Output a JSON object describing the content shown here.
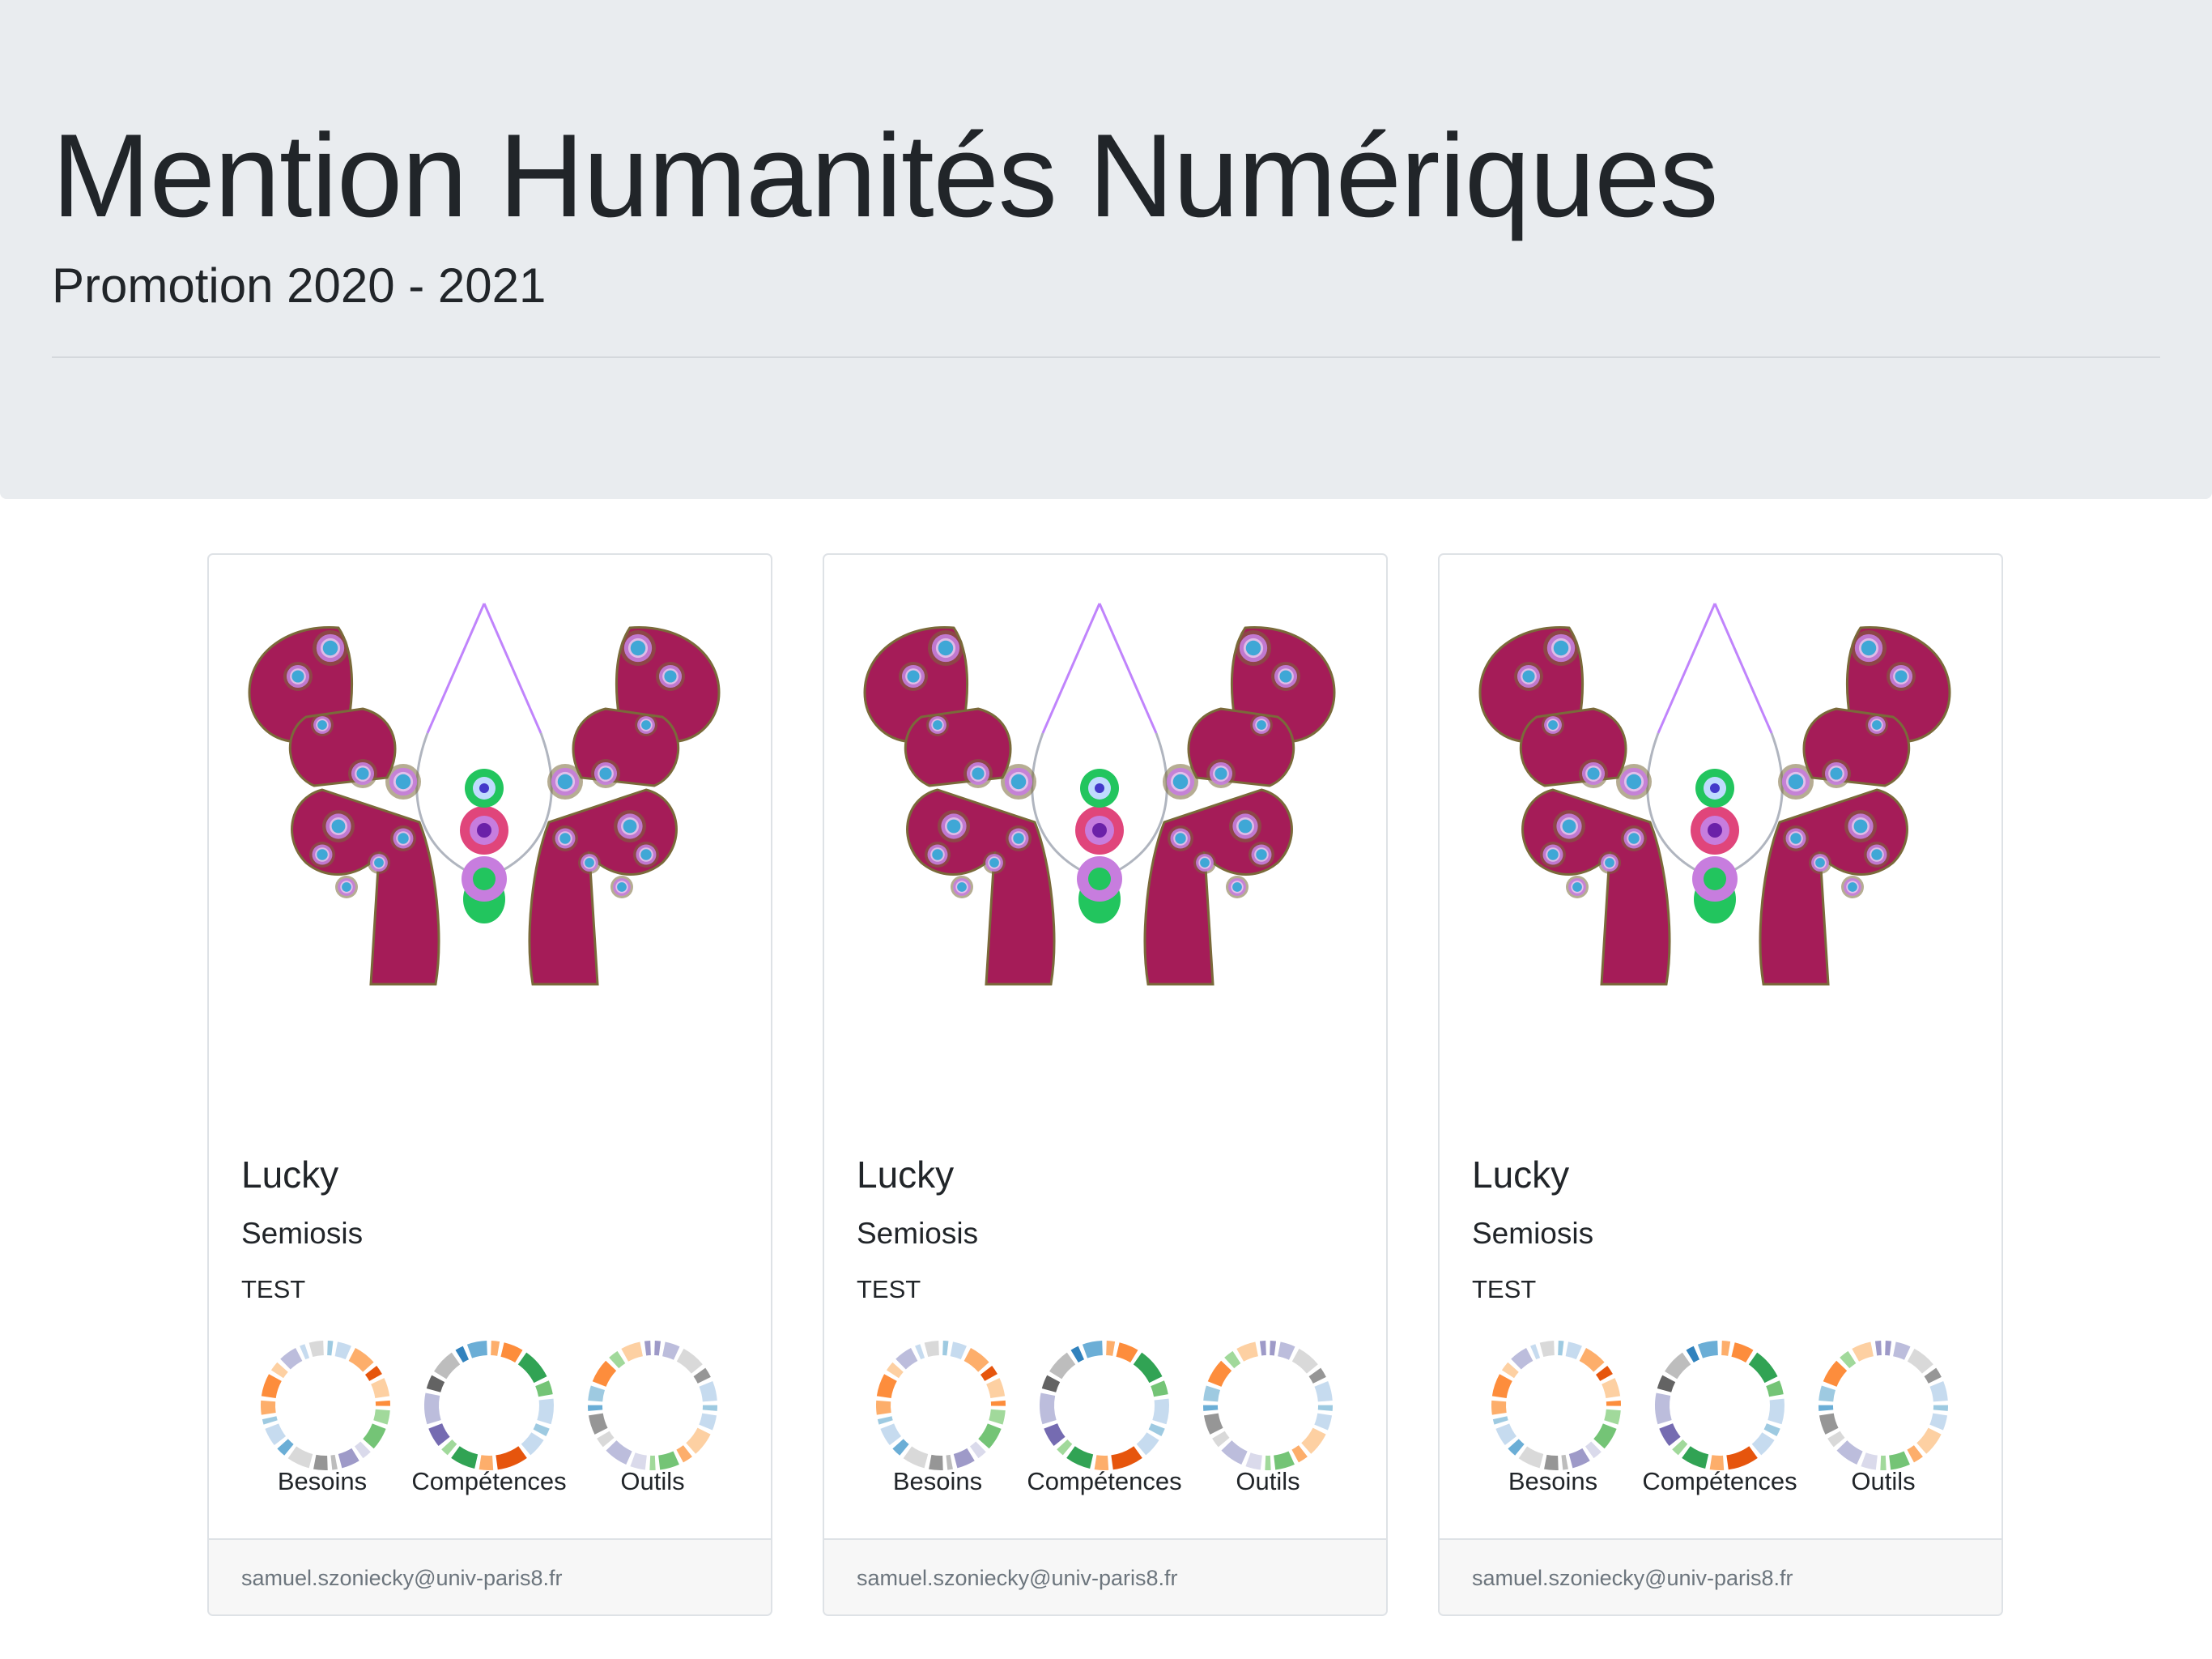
{
  "header": {
    "title": "Mention Humanités Numériques",
    "subtitle": "Promotion 2020 - 2021"
  },
  "cards": [
    {
      "image_icon": "butterfly-icon",
      "title": "Lucky",
      "subtitle": "Semiosis",
      "text": "TEST",
      "donuts": [
        {
          "label": "Besoins",
          "colors": [
            "#9ecae1",
            "#c6dbef",
            "#fdae6b",
            "#e6550d",
            "#fdd0a2",
            "#fd8d3c",
            "#a1d99b",
            "#74c476",
            "#dadaeb",
            "#9e9ac8",
            "#bdbdbd",
            "#969696",
            "#d9d9d9",
            "#6baed6",
            "#c6dbef",
            "#9ecae1",
            "#fdae6b",
            "#fd8d3c",
            "#fdd0a2",
            "#bcbddc",
            "#c6dbef",
            "#d9d9d9"
          ]
        },
        {
          "label": "Compétences",
          "colors": [
            "#fdae6b",
            "#fd8d3c",
            "#31a354",
            "#74c476",
            "#c6dbef",
            "#9ecae1",
            "#c6dbef",
            "#e6550d",
            "#fdae6b",
            "#31a354",
            "#a1d99b",
            "#756bb1",
            "#bcbddc",
            "#636363",
            "#bdbdbd",
            "#3182bd",
            "#6baed6"
          ]
        },
        {
          "label": "Outils",
          "colors": [
            "#9e9ac8",
            "#bcbddc",
            "#d9d9d9",
            "#969696",
            "#c6dbef",
            "#9ecae1",
            "#c6dbef",
            "#fdd0a2",
            "#fdae6b",
            "#74c476",
            "#a1d99b",
            "#dadaeb",
            "#bcbddc",
            "#d9d9d9",
            "#969696",
            "#6baed6",
            "#9ecae1",
            "#fd8d3c",
            "#a1d99b",
            "#fdd0a2",
            "#9e9ac8"
          ]
        }
      ],
      "footer": "samuel.szoniecky@univ-paris8.fr"
    },
    {
      "image_icon": "butterfly-icon",
      "title": "Lucky",
      "subtitle": "Semiosis",
      "text": "TEST",
      "donuts": [
        {
          "label": "Besoins",
          "colors": [
            "#9ecae1",
            "#c6dbef",
            "#fdae6b",
            "#e6550d",
            "#fdd0a2",
            "#fd8d3c",
            "#a1d99b",
            "#74c476",
            "#dadaeb",
            "#9e9ac8",
            "#bdbdbd",
            "#969696",
            "#d9d9d9",
            "#6baed6",
            "#c6dbef",
            "#9ecae1",
            "#fdae6b",
            "#fd8d3c",
            "#fdd0a2",
            "#bcbddc",
            "#c6dbef",
            "#d9d9d9"
          ]
        },
        {
          "label": "Compétences",
          "colors": [
            "#fdae6b",
            "#fd8d3c",
            "#31a354",
            "#74c476",
            "#c6dbef",
            "#9ecae1",
            "#c6dbef",
            "#e6550d",
            "#fdae6b",
            "#31a354",
            "#a1d99b",
            "#756bb1",
            "#bcbddc",
            "#636363",
            "#bdbdbd",
            "#3182bd",
            "#6baed6"
          ]
        },
        {
          "label": "Outils",
          "colors": [
            "#9e9ac8",
            "#bcbddc",
            "#d9d9d9",
            "#969696",
            "#c6dbef",
            "#9ecae1",
            "#c6dbef",
            "#fdd0a2",
            "#fdae6b",
            "#74c476",
            "#a1d99b",
            "#dadaeb",
            "#bcbddc",
            "#d9d9d9",
            "#969696",
            "#6baed6",
            "#9ecae1",
            "#fd8d3c",
            "#a1d99b",
            "#fdd0a2",
            "#9e9ac8"
          ]
        }
      ],
      "footer": "samuel.szoniecky@univ-paris8.fr"
    },
    {
      "image_icon": "butterfly-icon",
      "title": "Lucky",
      "subtitle": "Semiosis",
      "text": "TEST",
      "donuts": [
        {
          "label": "Besoins",
          "colors": [
            "#9ecae1",
            "#c6dbef",
            "#fdae6b",
            "#e6550d",
            "#fdd0a2",
            "#fd8d3c",
            "#a1d99b",
            "#74c476",
            "#dadaeb",
            "#9e9ac8",
            "#bdbdbd",
            "#969696",
            "#d9d9d9",
            "#6baed6",
            "#c6dbef",
            "#9ecae1",
            "#fdae6b",
            "#fd8d3c",
            "#fdd0a2",
            "#bcbddc",
            "#c6dbef",
            "#d9d9d9"
          ]
        },
        {
          "label": "Compétences",
          "colors": [
            "#fdae6b",
            "#fd8d3c",
            "#31a354",
            "#74c476",
            "#c6dbef",
            "#9ecae1",
            "#c6dbef",
            "#e6550d",
            "#fdae6b",
            "#31a354",
            "#a1d99b",
            "#756bb1",
            "#bcbddc",
            "#636363",
            "#bdbdbd",
            "#3182bd",
            "#6baed6"
          ]
        },
        {
          "label": "Outils",
          "colors": [
            "#9e9ac8",
            "#bcbddc",
            "#d9d9d9",
            "#969696",
            "#c6dbef",
            "#9ecae1",
            "#c6dbef",
            "#fdd0a2",
            "#fdae6b",
            "#74c476",
            "#a1d99b",
            "#dadaeb",
            "#bcbddc",
            "#d9d9d9",
            "#969696",
            "#6baed6",
            "#9ecae1",
            "#fd8d3c",
            "#a1d99b",
            "#fdd0a2",
            "#9e9ac8"
          ]
        }
      ],
      "footer": "samuel.szoniecky@univ-paris8.fr"
    }
  ],
  "colors": {
    "jumbotron_bg": "#e9ecef",
    "wing": "#a51c58",
    "wing_edge": "#7a6a3a",
    "eye_ring": "#c77dde",
    "eye_center": "#3fa7d6",
    "body_green": "#22c55e",
    "antenna": "#c084fc"
  }
}
